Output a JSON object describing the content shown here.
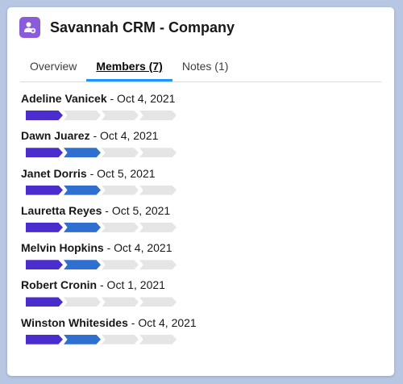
{
  "header": {
    "title": "Savannah CRM - Company",
    "icon": "company-icon"
  },
  "colors": {
    "stage_1": "#4b2dce",
    "stage_2": "#2f6fd0",
    "stage_empty": "#e5e5e5",
    "tab_accent": "#1b96ff"
  },
  "tabs": [
    {
      "label": "Overview",
      "active": false
    },
    {
      "label": "Members (7)",
      "active": true
    },
    {
      "label": "Notes (1)",
      "active": false
    }
  ],
  "members": [
    {
      "name": "Adeline Vanicek",
      "date": " - Oct 4, 2021",
      "progress": 1,
      "total_steps": 4
    },
    {
      "name": "Dawn Juarez",
      "date": " - Oct 4, 2021",
      "progress": 2,
      "total_steps": 4
    },
    {
      "name": "Janet Dorris",
      "date": " - Oct 5, 2021",
      "progress": 2,
      "total_steps": 4
    },
    {
      "name": "Lauretta Reyes",
      "date": " - Oct 5, 2021",
      "progress": 2,
      "total_steps": 4
    },
    {
      "name": "Melvin Hopkins",
      "date": " - Oct 4, 2021",
      "progress": 2,
      "total_steps": 4
    },
    {
      "name": "Robert Cronin",
      "date": " - Oct 1, 2021",
      "progress": 1,
      "total_steps": 4
    },
    {
      "name": "Winston Whitesides",
      "date": " - Oct 4, 2021",
      "progress": 2,
      "total_steps": 4
    }
  ]
}
